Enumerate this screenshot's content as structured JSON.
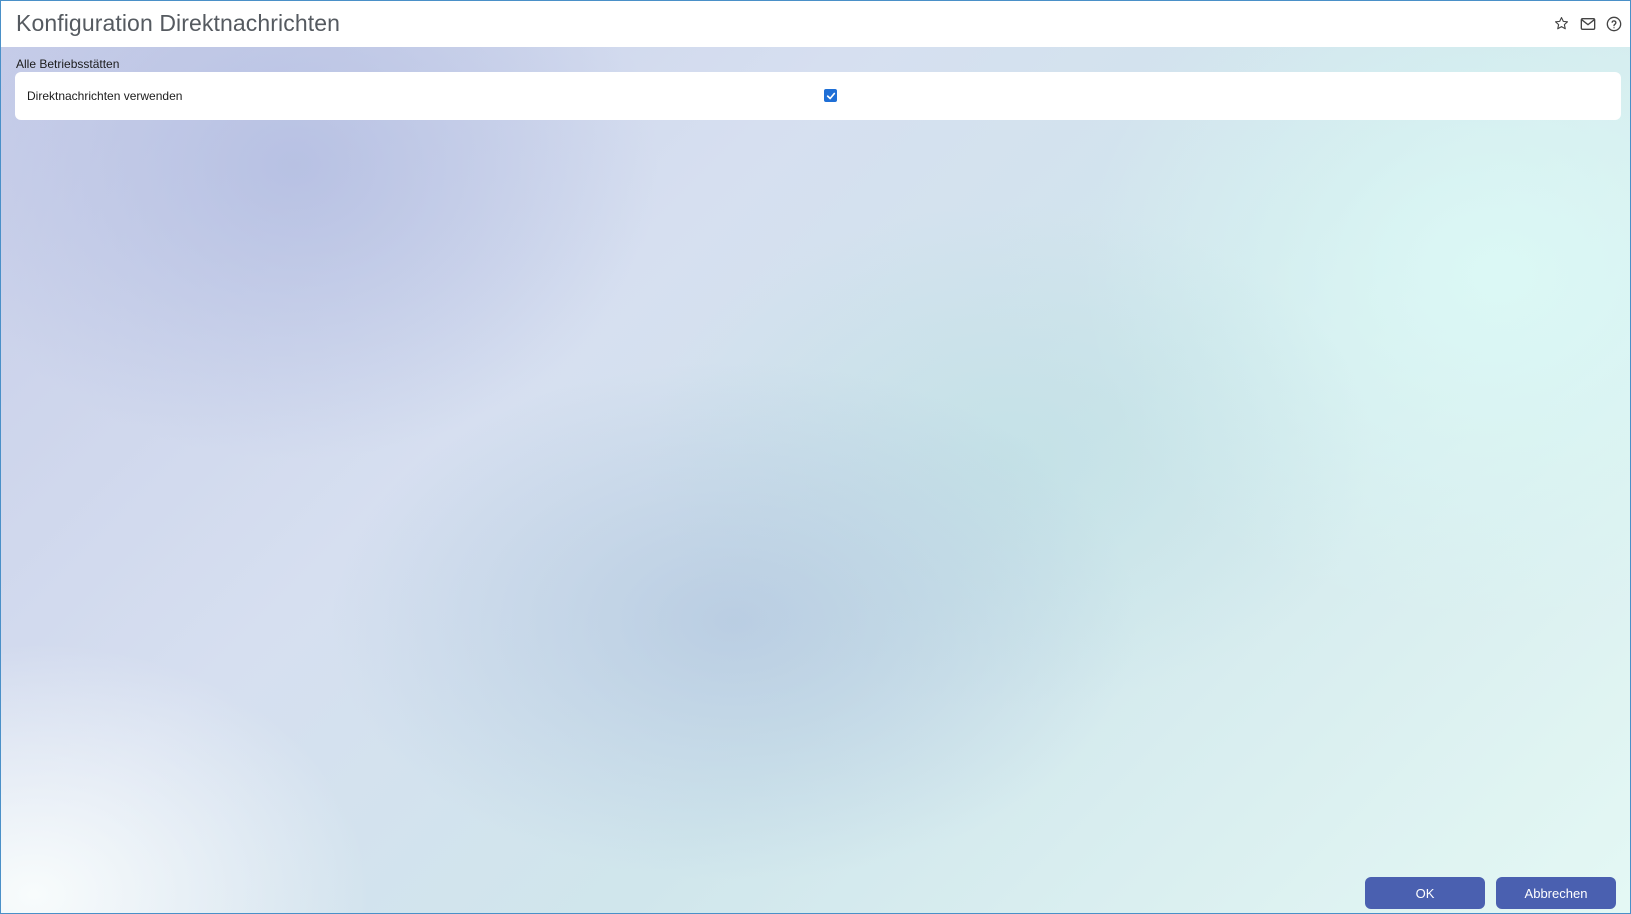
{
  "window": {
    "title": "Konfiguration Direktnachrichten"
  },
  "header_icons": [
    "star-icon",
    "mail-icon",
    "help-icon"
  ],
  "section": {
    "label": "Alle Betriebsstätten",
    "rows": [
      {
        "label": "Direktnachrichten verwenden",
        "checked": true
      }
    ]
  },
  "footer": {
    "ok_label": "OK",
    "cancel_label": "Abbrechen"
  },
  "colors": {
    "accent": "#4a60b0",
    "checkbox": "#1f6fd6",
    "title": "#555a60"
  }
}
